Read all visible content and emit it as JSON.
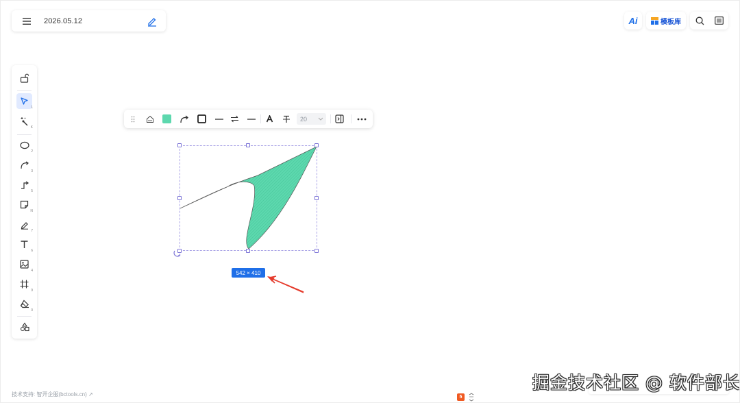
{
  "doc": {
    "title": "2026.05.12"
  },
  "topright": {
    "ai_label": "Ai",
    "template_label": "模板库"
  },
  "left_tools": [
    {
      "name": "lock",
      "shortcut": ""
    },
    {
      "name": "select",
      "shortcut": "1"
    },
    {
      "name": "magic",
      "shortcut": "K"
    },
    {
      "name": "ellipse",
      "shortcut": "2"
    },
    {
      "name": "curve",
      "shortcut": "3"
    },
    {
      "name": "connector",
      "shortcut": "5"
    },
    {
      "name": "sticky-note",
      "shortcut": "N"
    },
    {
      "name": "pen",
      "shortcut": "7"
    },
    {
      "name": "text",
      "shortcut": "6"
    },
    {
      "name": "image",
      "shortcut": "4"
    },
    {
      "name": "frame",
      "shortcut": "9"
    },
    {
      "name": "eraser",
      "shortcut": "0"
    },
    {
      "name": "shapes",
      "shortcut": ""
    }
  ],
  "shape_toolbar": {
    "fill_color": "#5dd8ae",
    "font_size": "20"
  },
  "selection": {
    "dimensions": "542 × 410"
  },
  "footer": {
    "credit": "技术支持: 智开企服(bctools.cn) ↗",
    "logo": "5"
  },
  "watermark": "掘金技术社区 @ 软件部长",
  "colors": {
    "accent": "#1f6fe8",
    "shape_fill": "#5dd8ae",
    "arrow": "#e53b2c"
  }
}
